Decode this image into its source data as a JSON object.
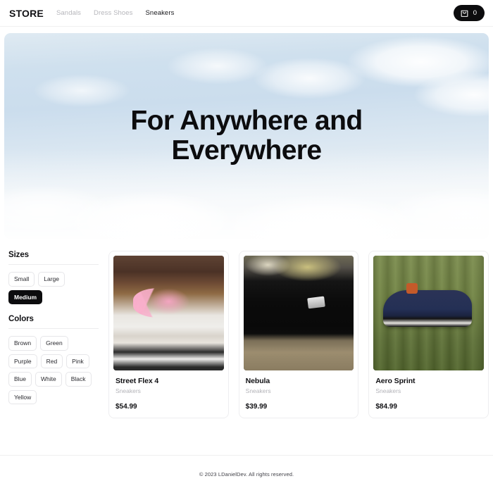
{
  "header": {
    "brand": "STORE",
    "nav": [
      {
        "label": "Sandals",
        "active": false
      },
      {
        "label": "Dress Shoes",
        "active": false
      },
      {
        "label": "Sneakers",
        "active": true
      }
    ],
    "cart": {
      "icon": "shopping-bag-icon",
      "count": "0"
    }
  },
  "hero": {
    "title": "For Anywhere and Everywhere",
    "image": "sky-with-clouds"
  },
  "filters": {
    "sizes": {
      "title": "Sizes",
      "options": [
        {
          "label": "Small",
          "selected": false
        },
        {
          "label": "Large",
          "selected": false
        },
        {
          "label": "Medium",
          "selected": true
        }
      ]
    },
    "colors": {
      "title": "Colors",
      "options": [
        {
          "label": "Brown",
          "selected": false
        },
        {
          "label": "Green",
          "selected": false
        },
        {
          "label": "Purple",
          "selected": false
        },
        {
          "label": "Red",
          "selected": false
        },
        {
          "label": "Pink",
          "selected": false
        },
        {
          "label": "Blue",
          "selected": false
        },
        {
          "label": "White",
          "selected": false
        },
        {
          "label": "Black",
          "selected": false
        },
        {
          "label": "Yellow",
          "selected": false
        }
      ]
    }
  },
  "products": [
    {
      "title": "Street Flex 4",
      "category": "Sneakers",
      "price": "$54.99",
      "image": "brown-white-sneaker-pink-laces"
    },
    {
      "title": "Nebula",
      "category": "Sneakers",
      "price": "$39.99",
      "image": "black-sneaker-on-pavement"
    },
    {
      "title": "Aero Sprint",
      "category": "Sneakers",
      "price": "$84.99",
      "image": "navy-sneaker-on-green-couch"
    }
  ],
  "footer": {
    "copyright": "© 2023  LDanielDev. All rights reserved."
  },
  "colors": {
    "accent": "#0c0c0e",
    "muted": "#b6b6bb",
    "border": "#eeeef0",
    "background": "#ffffff"
  }
}
